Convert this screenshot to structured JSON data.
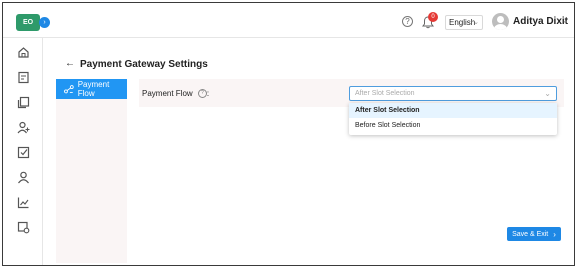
{
  "topbar": {
    "logo_text": "EO",
    "collapse_icon": "chevron-right-icon",
    "help_icon": "help-circle-icon",
    "notification_count": "0",
    "language": "English",
    "user_name": "Aditya Dixit"
  },
  "sidebar": {
    "items": [
      {
        "name": "home-icon"
      },
      {
        "name": "bookings-icon"
      },
      {
        "name": "documents-icon"
      },
      {
        "name": "add-user-icon"
      },
      {
        "name": "tasks-icon"
      },
      {
        "name": "user-icon"
      },
      {
        "name": "reports-icon"
      },
      {
        "name": "settings-icon"
      }
    ]
  },
  "page": {
    "title": "Payment Gateway Settings",
    "tabs": [
      {
        "label": "Payment Flow",
        "active": true
      }
    ]
  },
  "form": {
    "payment_flow_label": "Payment Flow",
    "label_suffix": ":",
    "select_placeholder": "After Slot Selection",
    "options": [
      "After Slot Selection",
      "Before Slot Selection"
    ],
    "highlighted_option": "After Slot Selection"
  },
  "actions": {
    "save_label": "Save & Exit"
  },
  "colors": {
    "accent": "#1e88e5",
    "logo": "#2e9a6a",
    "badge": "#e53935",
    "panel_bg": "#faf5f5"
  }
}
